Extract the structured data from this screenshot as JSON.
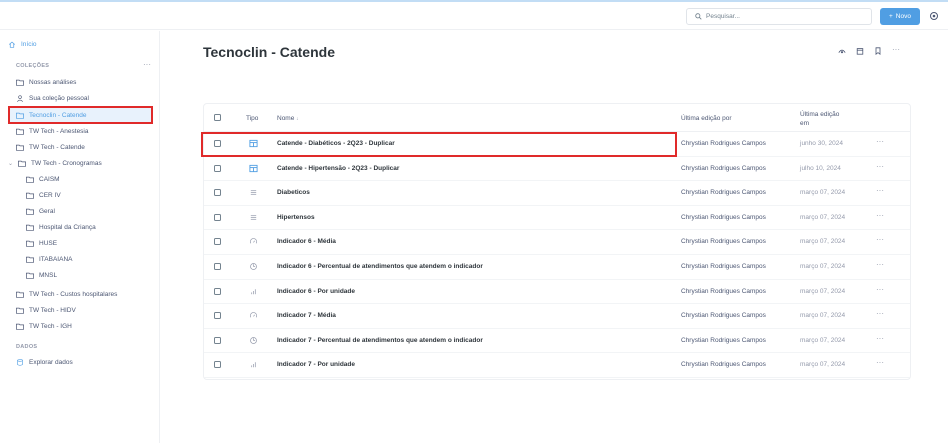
{
  "topbar": {
    "search_placeholder": "Pesquisar...",
    "new_button": "Novo"
  },
  "sidebar": {
    "home": "Início",
    "collections_header": "COLEÇÕES",
    "collections_more": "···",
    "items": [
      "Nossas análises",
      "Sua coleção pessoal",
      "Tecnoclin - Catende",
      "TW Tech - Anestesia",
      "TW Tech - Catende",
      "TW Tech - Cronogramas",
      "CAISM",
      "CER IV",
      "Geral",
      "Hospital da Criança",
      "HUSE",
      "ITABAIANA",
      "MNSL",
      "TW Tech - Custos hospitalares",
      "TW Tech - HIDV",
      "TW Tech - IGH"
    ],
    "data_header": "DADOS",
    "explore": "Explorar dados"
  },
  "main": {
    "title": "Tecnoclin - Catende",
    "columns": {
      "type": "Tipo",
      "name": "Nome",
      "sort_arrow": "↓",
      "edited_by": "Última edição por",
      "edited_at_1": "Última edição",
      "edited_at_2": "em"
    },
    "rows": [
      {
        "icon": "dashboard-icon",
        "name": "Catende - Diabéticos - 2Q23 - Duplicar",
        "user": "Chrystian Rodrigues Campos",
        "date": "junho 30, 2024"
      },
      {
        "icon": "dashboard-icon",
        "name": "Catende - Hipertensão - 2Q23 - Duplicar",
        "user": "Chrystian Rodrigues Campos",
        "date": "julho 10, 2024"
      },
      {
        "icon": "table-icon",
        "name": "Diabeticos",
        "user": "Chrystian Rodrigues Campos",
        "date": "março 07, 2024"
      },
      {
        "icon": "table-icon",
        "name": "Hipertensos",
        "user": "Chrystian Rodrigues Campos",
        "date": "março 07, 2024"
      },
      {
        "icon": "gauge-icon",
        "name": "Indicador 6 - Média",
        "user": "Chrystian Rodrigues Campos",
        "date": "março 07, 2024"
      },
      {
        "icon": "progress-icon",
        "name": "Indicador 6 - Percentual de atendimentos que atendem o indicador",
        "user": "Chrystian Rodrigues Campos",
        "date": "março 07, 2024"
      },
      {
        "icon": "bar-chart-icon",
        "name": "Indicador 6 - Por unidade",
        "user": "Chrystian Rodrigues Campos",
        "date": "março 07, 2024"
      },
      {
        "icon": "gauge-icon",
        "name": "Indicador 7 - Média",
        "user": "Chrystian Rodrigues Campos",
        "date": "março 07, 2024"
      },
      {
        "icon": "progress-icon",
        "name": "Indicador 7 - Percentual de atendimentos que atendem o indicador",
        "user": "Chrystian Rodrigues Campos",
        "date": "março 07, 2024"
      },
      {
        "icon": "bar-chart-icon",
        "name": "Indicador 7 - Por unidade",
        "user": "Chrystian Rodrigues Campos",
        "date": "março 07, 2024"
      }
    ],
    "more": "···"
  },
  "colors": {
    "brand": "#509ee3",
    "highlight": "#e02a2a",
    "selected_bg": "#e8f2fc"
  }
}
